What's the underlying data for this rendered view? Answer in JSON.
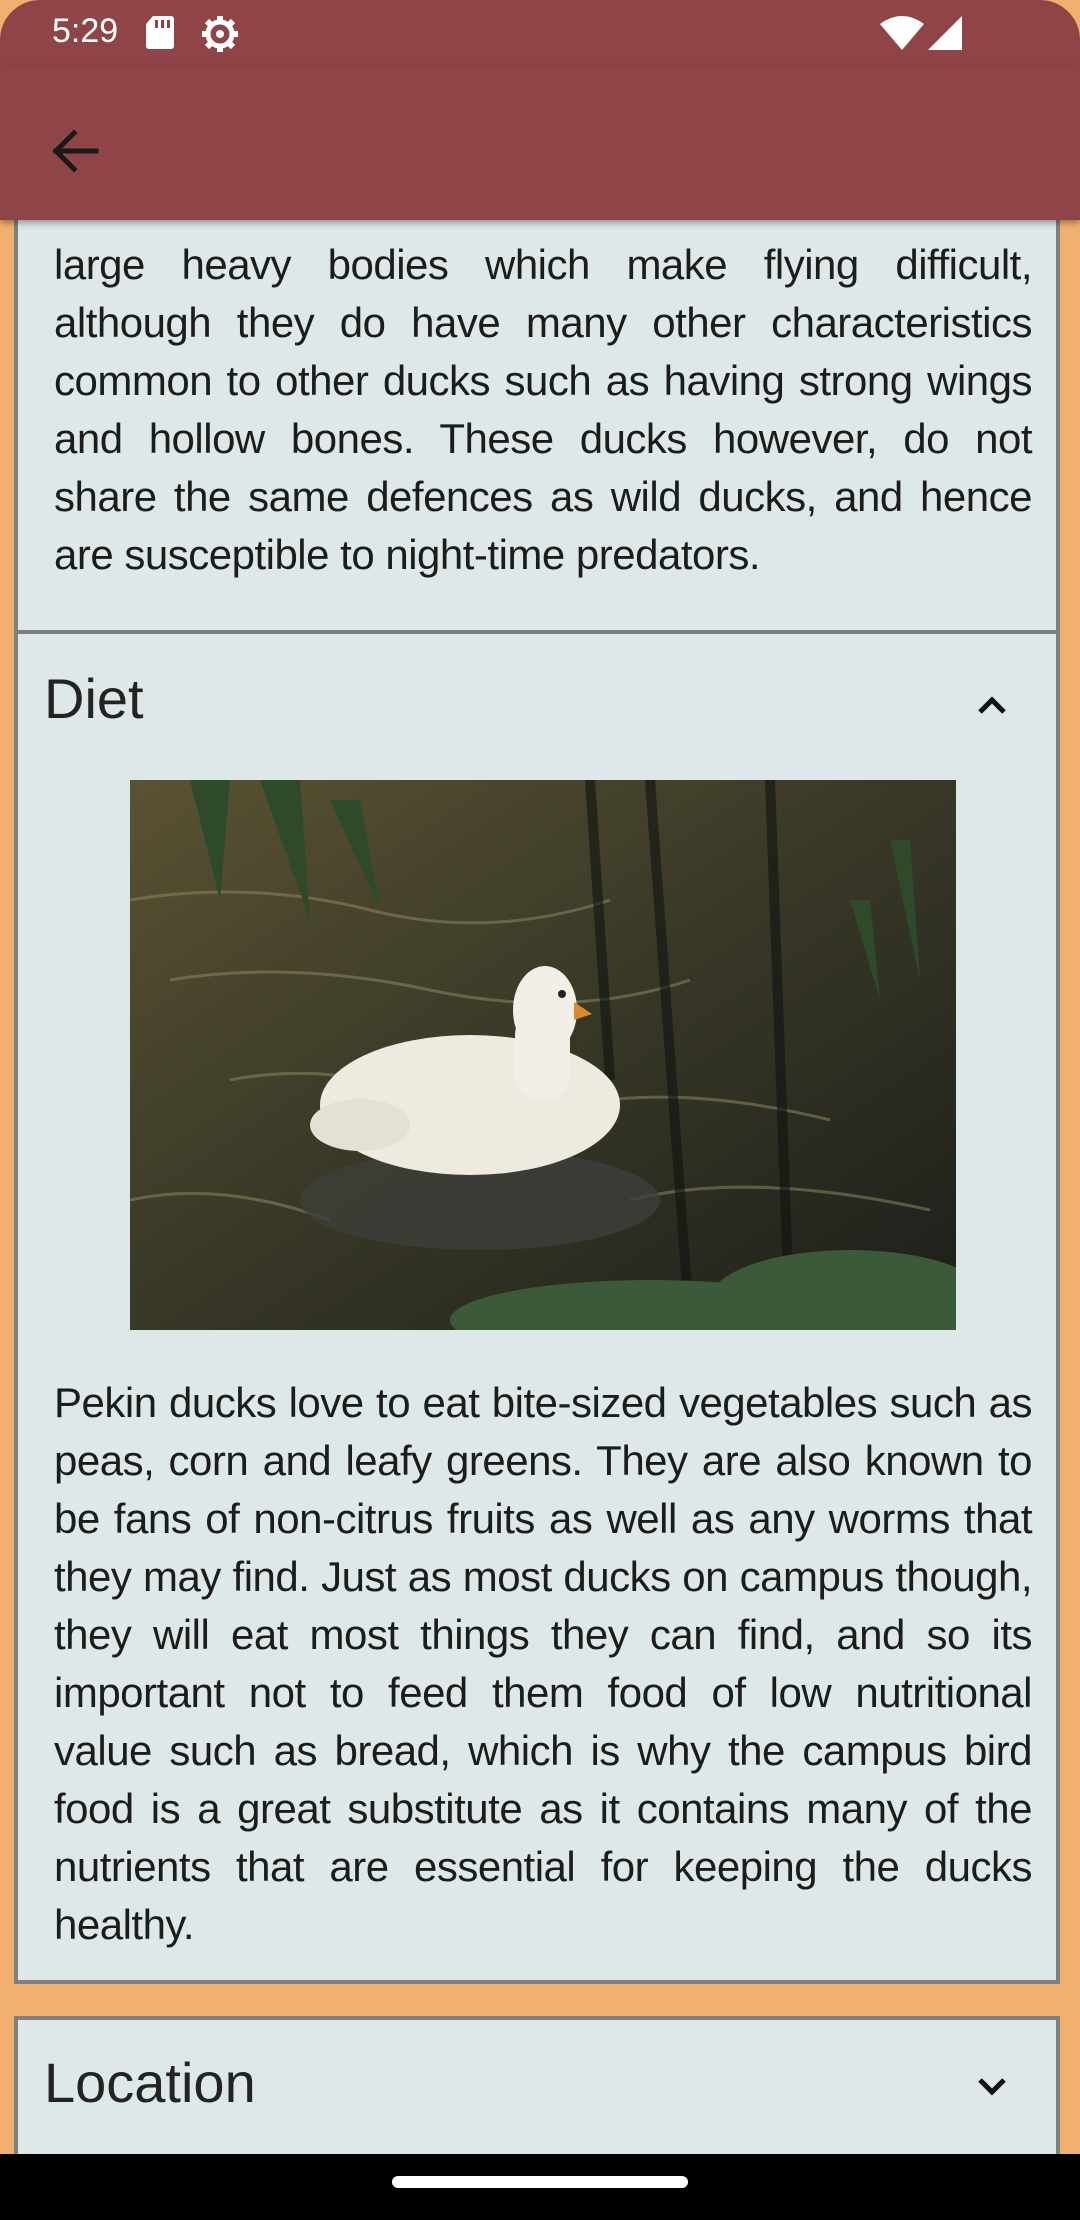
{
  "status_bar": {
    "time": "5:29",
    "icons": [
      "sd-card-icon",
      "settings-gear-icon",
      "wifi-icon",
      "signal-icon"
    ]
  },
  "app_bar": {
    "back_icon": "arrow-back-icon",
    "background_color": "#8f4547"
  },
  "colors": {
    "page_background": "#f0b06f",
    "card_background": "#dfe8e8",
    "card_border": "#7f7f7f"
  },
  "sections": [
    {
      "id": "characteristics",
      "body": "large heavy bodies which make flying difficult, although they do have many other characteristics common to other ducks such as having strong wings and hollow bones. These ducks however, do not share the same defences as wild ducks, and hence are susceptible to night-time predators."
    },
    {
      "id": "diet",
      "title": "Diet",
      "expanded": true,
      "toggle_icon": "chevron-up-icon",
      "image": "white-pekin-duck-on-pond-photo",
      "body": "Pekin ducks love to eat bite-sized vegetables such as peas, corn and leafy greens. They are also known to be fans of non-citrus fruits as well as any worms that they may find. Just as most ducks on campus though, they will eat most things they can find, and so its important not to feed them food of low nutritional value such as bread, which is why the campus bird food is a great substitute as it contains many of the nutrients that are essential for keeping the ducks healthy."
    },
    {
      "id": "location",
      "title": "Location",
      "expanded": false,
      "toggle_icon": "chevron-down-icon"
    }
  ]
}
